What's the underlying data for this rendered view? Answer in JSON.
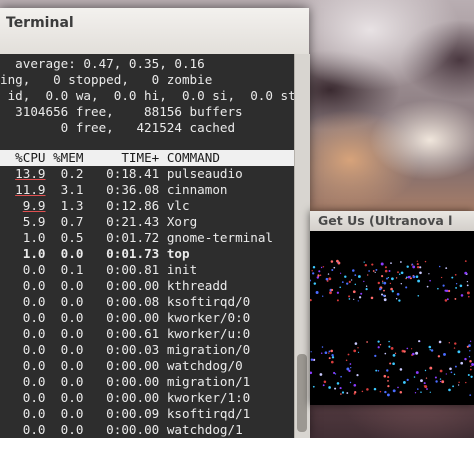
{
  "terminal": {
    "title": "Terminal",
    "summary_lines": [
      "  average: 0.47, 0.35, 0.16",
      "ing,   0 stopped,   0 zombie",
      " id,  0.0 wa,  0.0 hi,  0.0 si,  0.0 st",
      "  3104656 free,    88156 buffers",
      "        0 free,   421524 cached"
    ],
    "columns": [
      "%CPU",
      "%MEM",
      "TIME+",
      "COMMAND"
    ],
    "processes": [
      {
        "cpu": "13.9",
        "mem": "0.2",
        "time": "0:18.41",
        "command": "pulseaudio"
      },
      {
        "cpu": "11.9",
        "mem": "3.1",
        "time": "0:36.08",
        "command": "cinnamon"
      },
      {
        "cpu": "9.9",
        "mem": "1.3",
        "time": "0:12.86",
        "command": "vlc"
      },
      {
        "cpu": "5.9",
        "mem": "0.7",
        "time": "0:21.43",
        "command": "Xorg"
      },
      {
        "cpu": "1.0",
        "mem": "0.5",
        "time": "0:01.72",
        "command": "gnome-terminal"
      },
      {
        "cpu": "1.0",
        "mem": "0.0",
        "time": "0:01.73",
        "command": "top"
      },
      {
        "cpu": "0.0",
        "mem": "0.1",
        "time": "0:00.81",
        "command": "init"
      },
      {
        "cpu": "0.0",
        "mem": "0.0",
        "time": "0:00.00",
        "command": "kthreadd"
      },
      {
        "cpu": "0.0",
        "mem": "0.0",
        "time": "0:00.08",
        "command": "ksoftirqd/0"
      },
      {
        "cpu": "0.0",
        "mem": "0.0",
        "time": "0:00.00",
        "command": "kworker/0:0"
      },
      {
        "cpu": "0.0",
        "mem": "0.0",
        "time": "0:00.61",
        "command": "kworker/u:0"
      },
      {
        "cpu": "0.0",
        "mem": "0.0",
        "time": "0:00.03",
        "command": "migration/0"
      },
      {
        "cpu": "0.0",
        "mem": "0.0",
        "time": "0:00.00",
        "command": "watchdog/0"
      },
      {
        "cpu": "0.0",
        "mem": "0.0",
        "time": "0:00.00",
        "command": "migration/1"
      },
      {
        "cpu": "0.0",
        "mem": "0.0",
        "time": "0:00.00",
        "command": "kworker/1:0"
      },
      {
        "cpu": "0.0",
        "mem": "0.0",
        "time": "0:00.09",
        "command": "ksoftirqd/1"
      },
      {
        "cpu": "0.0",
        "mem": "0.0",
        "time": "0:00.00",
        "command": "watchdog/1"
      }
    ]
  },
  "media_window": {
    "title": "Get Us (Ultranova l"
  },
  "colors": {
    "terminal_bg": "#2d2d2d",
    "terminal_fg": "#eaeaea",
    "header_bg": "#f0f0f0",
    "underline": "#e05050"
  }
}
